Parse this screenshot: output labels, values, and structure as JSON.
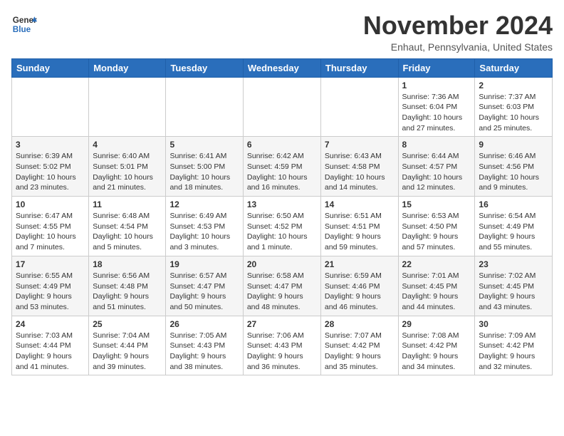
{
  "header": {
    "logo_general": "General",
    "logo_blue": "Blue",
    "month_title": "November 2024",
    "location": "Enhaut, Pennsylvania, United States"
  },
  "days_of_week": [
    "Sunday",
    "Monday",
    "Tuesday",
    "Wednesday",
    "Thursday",
    "Friday",
    "Saturday"
  ],
  "weeks": [
    [
      {
        "day": "",
        "info": ""
      },
      {
        "day": "",
        "info": ""
      },
      {
        "day": "",
        "info": ""
      },
      {
        "day": "",
        "info": ""
      },
      {
        "day": "",
        "info": ""
      },
      {
        "day": "1",
        "info": "Sunrise: 7:36 AM\nSunset: 6:04 PM\nDaylight: 10 hours\nand 27 minutes."
      },
      {
        "day": "2",
        "info": "Sunrise: 7:37 AM\nSunset: 6:03 PM\nDaylight: 10 hours\nand 25 minutes."
      }
    ],
    [
      {
        "day": "3",
        "info": "Sunrise: 6:39 AM\nSunset: 5:02 PM\nDaylight: 10 hours\nand 23 minutes."
      },
      {
        "day": "4",
        "info": "Sunrise: 6:40 AM\nSunset: 5:01 PM\nDaylight: 10 hours\nand 21 minutes."
      },
      {
        "day": "5",
        "info": "Sunrise: 6:41 AM\nSunset: 5:00 PM\nDaylight: 10 hours\nand 18 minutes."
      },
      {
        "day": "6",
        "info": "Sunrise: 6:42 AM\nSunset: 4:59 PM\nDaylight: 10 hours\nand 16 minutes."
      },
      {
        "day": "7",
        "info": "Sunrise: 6:43 AM\nSunset: 4:58 PM\nDaylight: 10 hours\nand 14 minutes."
      },
      {
        "day": "8",
        "info": "Sunrise: 6:44 AM\nSunset: 4:57 PM\nDaylight: 10 hours\nand 12 minutes."
      },
      {
        "day": "9",
        "info": "Sunrise: 6:46 AM\nSunset: 4:56 PM\nDaylight: 10 hours\nand 9 minutes."
      }
    ],
    [
      {
        "day": "10",
        "info": "Sunrise: 6:47 AM\nSunset: 4:55 PM\nDaylight: 10 hours\nand 7 minutes."
      },
      {
        "day": "11",
        "info": "Sunrise: 6:48 AM\nSunset: 4:54 PM\nDaylight: 10 hours\nand 5 minutes."
      },
      {
        "day": "12",
        "info": "Sunrise: 6:49 AM\nSunset: 4:53 PM\nDaylight: 10 hours\nand 3 minutes."
      },
      {
        "day": "13",
        "info": "Sunrise: 6:50 AM\nSunset: 4:52 PM\nDaylight: 10 hours\nand 1 minute."
      },
      {
        "day": "14",
        "info": "Sunrise: 6:51 AM\nSunset: 4:51 PM\nDaylight: 9 hours\nand 59 minutes."
      },
      {
        "day": "15",
        "info": "Sunrise: 6:53 AM\nSunset: 4:50 PM\nDaylight: 9 hours\nand 57 minutes."
      },
      {
        "day": "16",
        "info": "Sunrise: 6:54 AM\nSunset: 4:49 PM\nDaylight: 9 hours\nand 55 minutes."
      }
    ],
    [
      {
        "day": "17",
        "info": "Sunrise: 6:55 AM\nSunset: 4:49 PM\nDaylight: 9 hours\nand 53 minutes."
      },
      {
        "day": "18",
        "info": "Sunrise: 6:56 AM\nSunset: 4:48 PM\nDaylight: 9 hours\nand 51 minutes."
      },
      {
        "day": "19",
        "info": "Sunrise: 6:57 AM\nSunset: 4:47 PM\nDaylight: 9 hours\nand 50 minutes."
      },
      {
        "day": "20",
        "info": "Sunrise: 6:58 AM\nSunset: 4:47 PM\nDaylight: 9 hours\nand 48 minutes."
      },
      {
        "day": "21",
        "info": "Sunrise: 6:59 AM\nSunset: 4:46 PM\nDaylight: 9 hours\nand 46 minutes."
      },
      {
        "day": "22",
        "info": "Sunrise: 7:01 AM\nSunset: 4:45 PM\nDaylight: 9 hours\nand 44 minutes."
      },
      {
        "day": "23",
        "info": "Sunrise: 7:02 AM\nSunset: 4:45 PM\nDaylight: 9 hours\nand 43 minutes."
      }
    ],
    [
      {
        "day": "24",
        "info": "Sunrise: 7:03 AM\nSunset: 4:44 PM\nDaylight: 9 hours\nand 41 minutes."
      },
      {
        "day": "25",
        "info": "Sunrise: 7:04 AM\nSunset: 4:44 PM\nDaylight: 9 hours\nand 39 minutes."
      },
      {
        "day": "26",
        "info": "Sunrise: 7:05 AM\nSunset: 4:43 PM\nDaylight: 9 hours\nand 38 minutes."
      },
      {
        "day": "27",
        "info": "Sunrise: 7:06 AM\nSunset: 4:43 PM\nDaylight: 9 hours\nand 36 minutes."
      },
      {
        "day": "28",
        "info": "Sunrise: 7:07 AM\nSunset: 4:42 PM\nDaylight: 9 hours\nand 35 minutes."
      },
      {
        "day": "29",
        "info": "Sunrise: 7:08 AM\nSunset: 4:42 PM\nDaylight: 9 hours\nand 34 minutes."
      },
      {
        "day": "30",
        "info": "Sunrise: 7:09 AM\nSunset: 4:42 PM\nDaylight: 9 hours\nand 32 minutes."
      }
    ]
  ]
}
